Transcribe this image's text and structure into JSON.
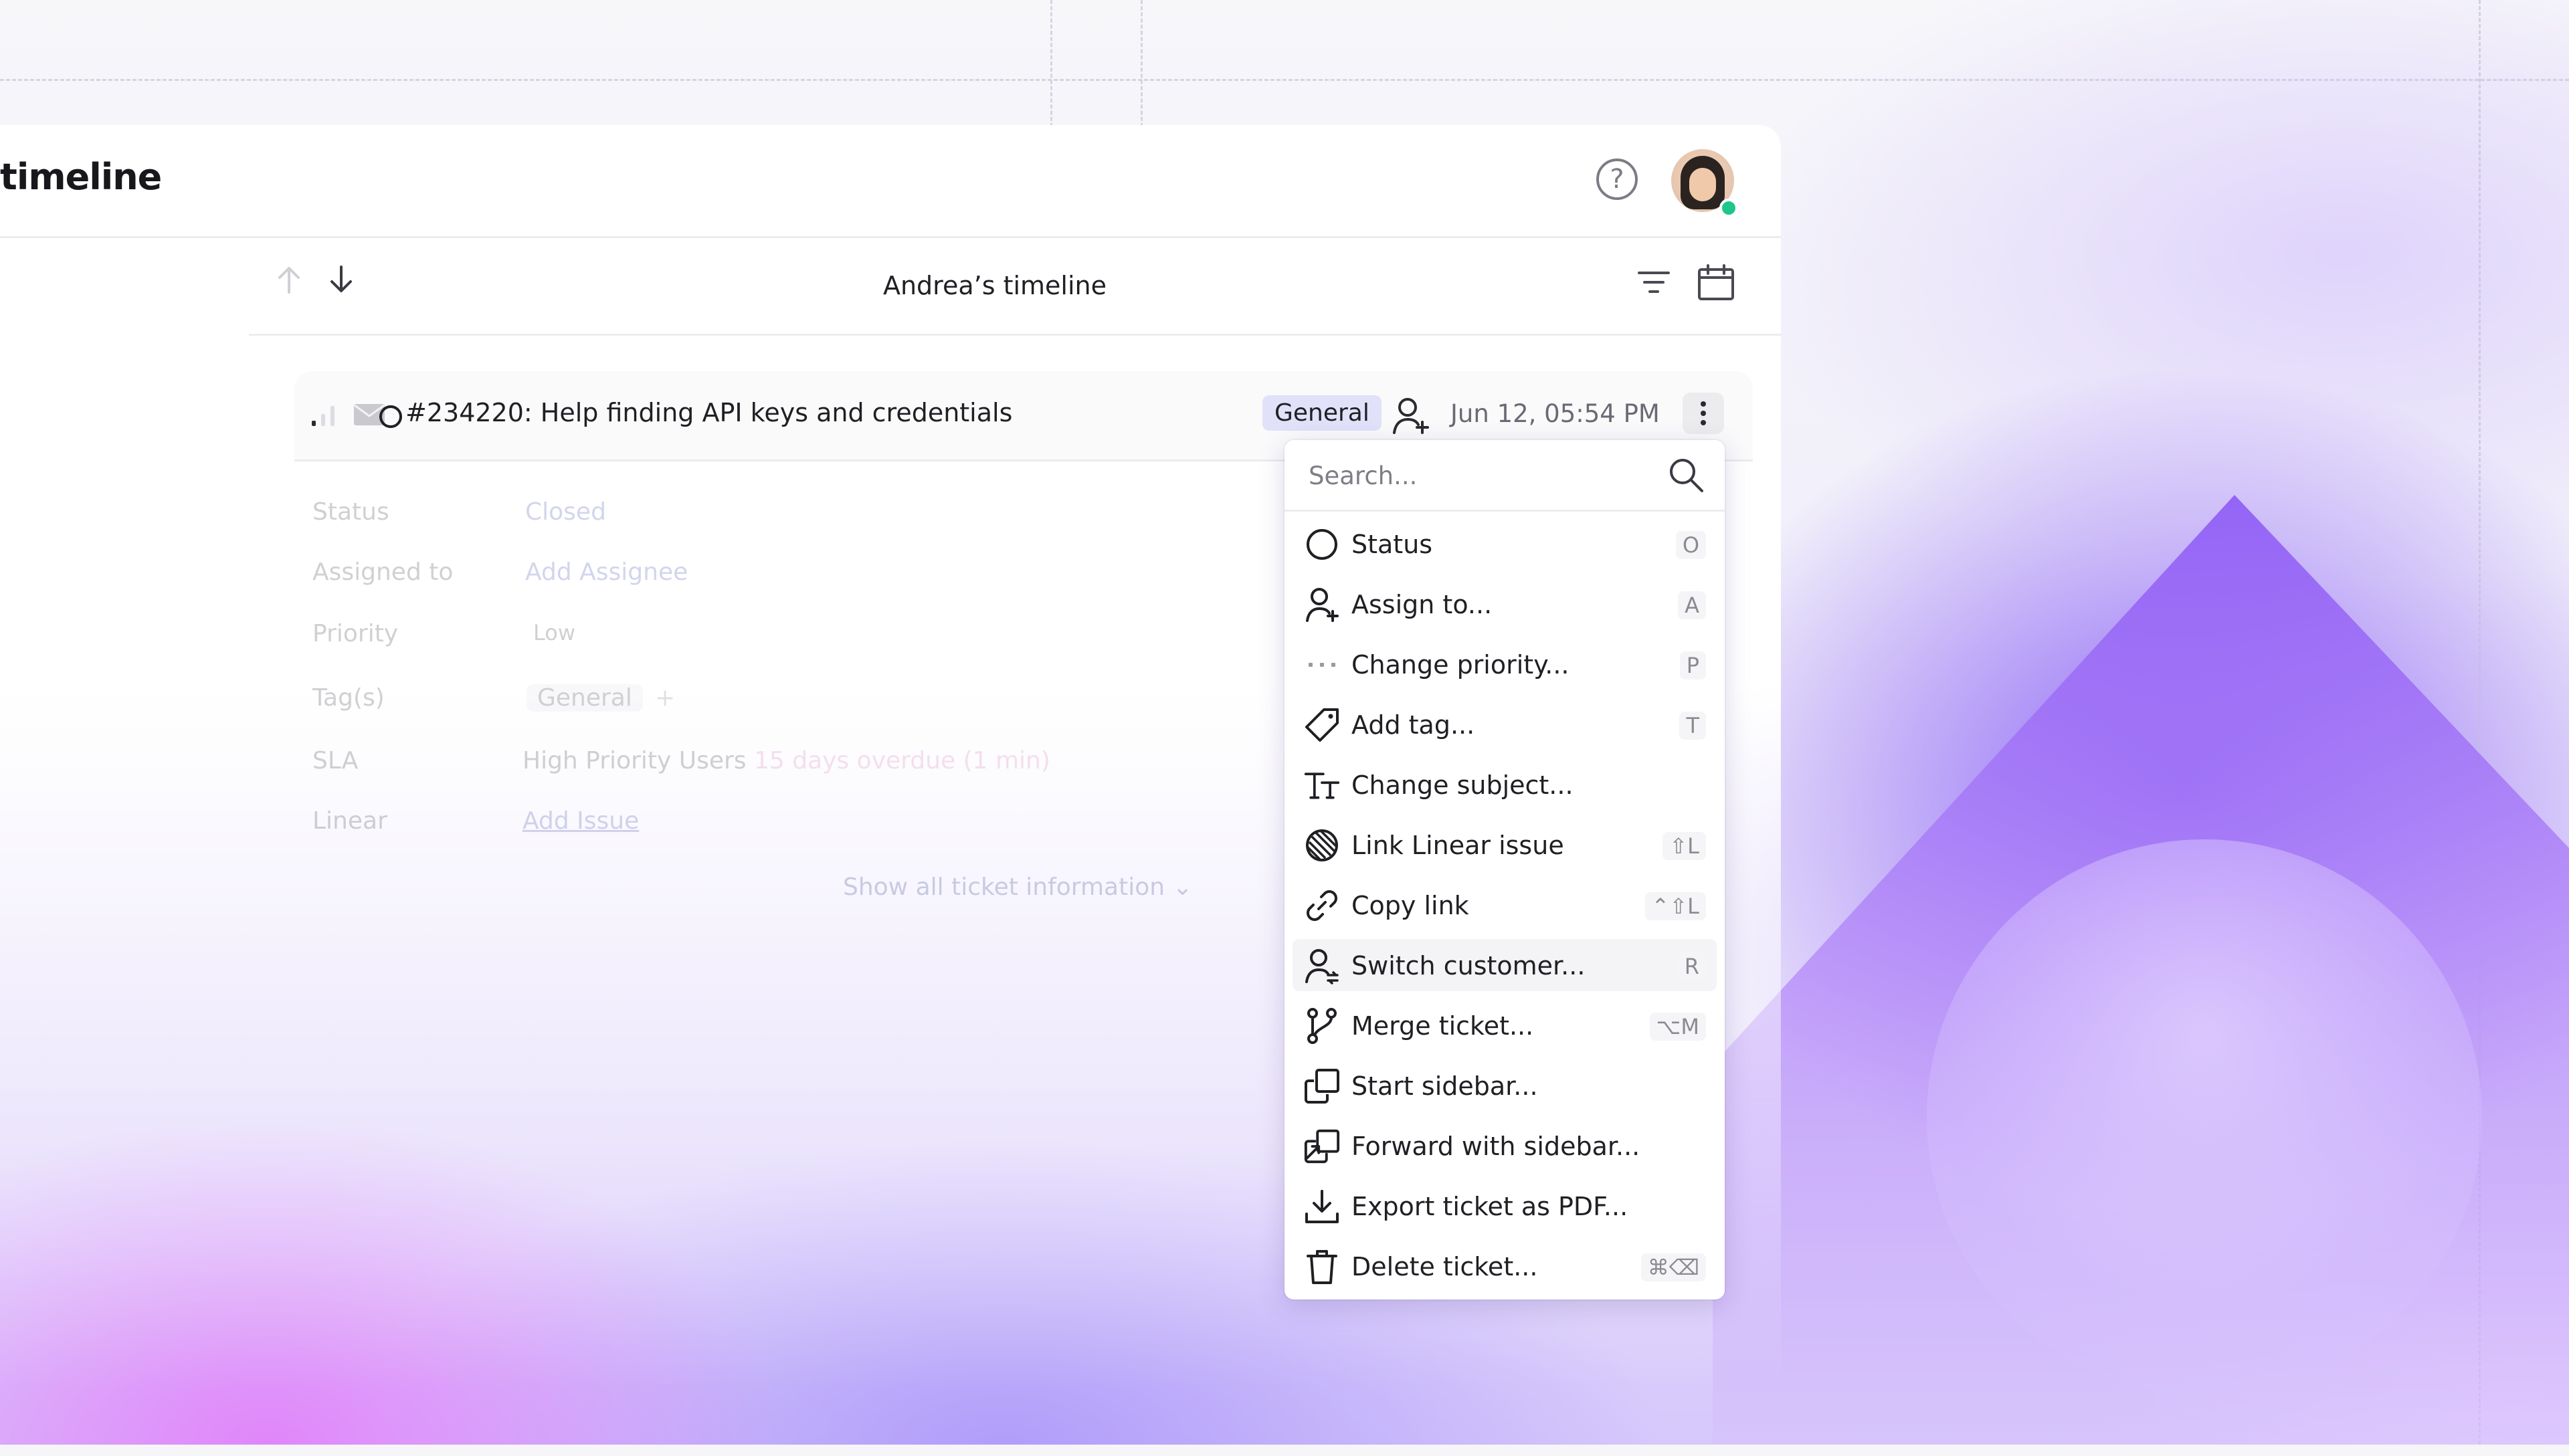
{
  "app": {
    "title": "timeline"
  },
  "header": {
    "help_icon": "question-circle-icon",
    "avatar_alt": "user-avatar"
  },
  "subbar": {
    "title": "Andrea’s timeline"
  },
  "ticket": {
    "subject": "#234220: Help finding API keys and credentials",
    "tag": "General",
    "date": "Jun 12, 05:54 PM"
  },
  "properties": [
    {
      "label": "Status",
      "value": "Closed"
    },
    {
      "label": "Assigned to",
      "value": "Add Assignee"
    },
    {
      "label": "Priority",
      "value": "Low"
    },
    {
      "label": "Tag(s)",
      "value": "General"
    },
    {
      "label": "SLA",
      "value": "High Priority Users",
      "extra": "15 days overdue (1 min)"
    },
    {
      "label": "Linear",
      "value": "Add Issue"
    }
  ],
  "show_all": "Show all ticket information",
  "menu": {
    "search_placeholder": "Search...",
    "items": [
      {
        "label": "Status",
        "shortcut": "O",
        "icon": "circle-icon"
      },
      {
        "label": "Assign to...",
        "shortcut": "A",
        "icon": "user-plus-icon"
      },
      {
        "label": "Change priority...",
        "shortcut": "P",
        "icon": "dots-icon"
      },
      {
        "label": "Add tag...",
        "shortcut": "T",
        "icon": "tag-icon"
      },
      {
        "label": "Change subject...",
        "shortcut": "",
        "icon": "text-icon"
      },
      {
        "label": "Link Linear issue",
        "shortcut": "⇧L",
        "icon": "linear-icon"
      },
      {
        "label": "Copy link",
        "shortcut": "⌃⇧L",
        "icon": "link-icon"
      },
      {
        "label": "Switch customer...",
        "shortcut": "R",
        "icon": "user-switch-icon"
      },
      {
        "label": "Merge ticket...",
        "shortcut": "⌥M",
        "icon": "merge-icon"
      },
      {
        "label": "Start sidebar...",
        "shortcut": "",
        "icon": "sidebar-icon"
      },
      {
        "label": "Forward with sidebar...",
        "shortcut": "",
        "icon": "forward-icon"
      },
      {
        "label": "Export ticket as PDF...",
        "shortcut": "",
        "icon": "download-icon"
      },
      {
        "label": "Delete ticket...",
        "shortcut": "⌘⌫",
        "icon": "trash-icon"
      }
    ]
  }
}
